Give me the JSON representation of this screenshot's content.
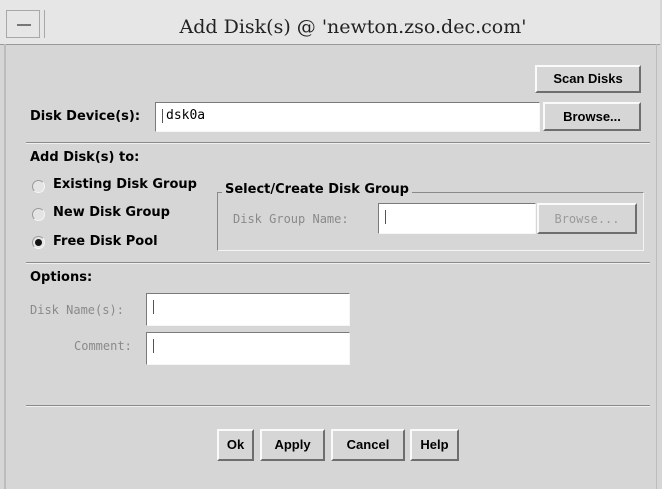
{
  "window": {
    "title": "Add Disk(s) @ 'newton.zso.dec.com'"
  },
  "top": {
    "scan_button": "Scan Disks",
    "device_label": "Disk Device(s):",
    "device_value": "dsk0a",
    "browse_button": "Browse..."
  },
  "add_to": {
    "heading": "Add Disk(s) to:",
    "options": [
      {
        "label": "Existing Disk Group",
        "selected": false
      },
      {
        "label": "New Disk Group",
        "selected": false
      },
      {
        "label": "Free Disk Pool",
        "selected": true
      }
    ]
  },
  "group_box": {
    "legend": "Select/Create Disk Group",
    "name_label": "Disk Group Name:",
    "name_value": "",
    "browse_button": "Browse..."
  },
  "options": {
    "heading": "Options:",
    "disk_name_label": "Disk Name(s):",
    "disk_name_value": "",
    "comment_label": "Comment:",
    "comment_value": ""
  },
  "footer": {
    "ok": "Ok",
    "apply": "Apply",
    "cancel": "Cancel",
    "help": "Help"
  }
}
